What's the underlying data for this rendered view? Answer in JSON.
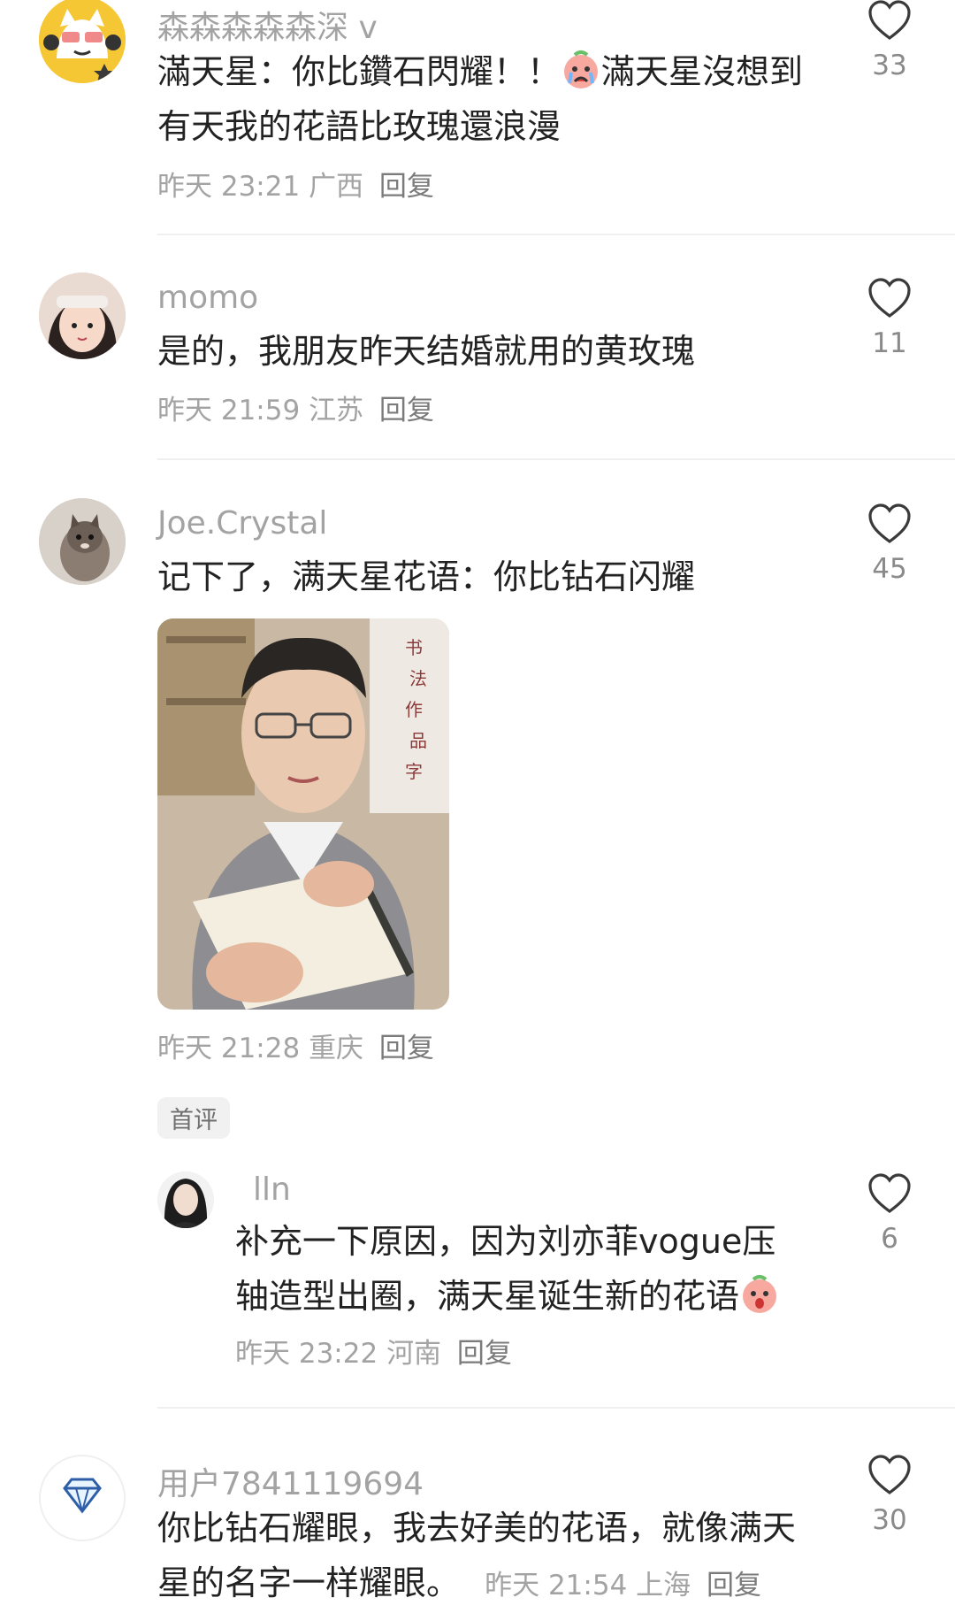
{
  "comments": [
    {
      "user": "森森森森森深 v",
      "line1": "滿天星：你比鑽石閃耀！！",
      "line1b": "滿天星沒想到",
      "line2": "有天我的花語比玫瑰還浪漫",
      "time": "昨天 23:21",
      "region": "广西",
      "reply": "回复",
      "likes": "33"
    },
    {
      "user": "momo",
      "line1": "是的，我朋友昨天结婚就用的黄玫瑰",
      "time": "昨天 21:59",
      "region": "江苏",
      "reply": "回复",
      "likes": "11"
    },
    {
      "user": "Joe.Crystal",
      "line1": "记下了，满天星花语：你比钻石闪耀",
      "time": "昨天 21:28",
      "region": "重庆",
      "reply": "回复",
      "likes": "45",
      "badge": "首评"
    },
    {
      "user": "lln",
      "line1": "补充一下原因，因为刘亦菲vogue压",
      "line2": "轴造型出圈，满天星诞生新的花语",
      "time": "昨天 23:22",
      "region": "河南",
      "reply": "回复",
      "likes": "6"
    },
    {
      "user": "用户7841119694",
      "line1": "你比钻石耀眼，我去好美的花语，就像满天",
      "line2": "星的名字一样耀眼。",
      "time": "昨天 21:54",
      "region": "上海",
      "reply": "回复",
      "likes": "30"
    }
  ],
  "colors": {
    "muted": "#a3a3a3",
    "text": "#222222",
    "divider": "#efefef"
  },
  "icons": [
    "heart-outline-icon",
    "crying-face-emoji",
    "surprised-face-emoji",
    "diamond-icon"
  ]
}
